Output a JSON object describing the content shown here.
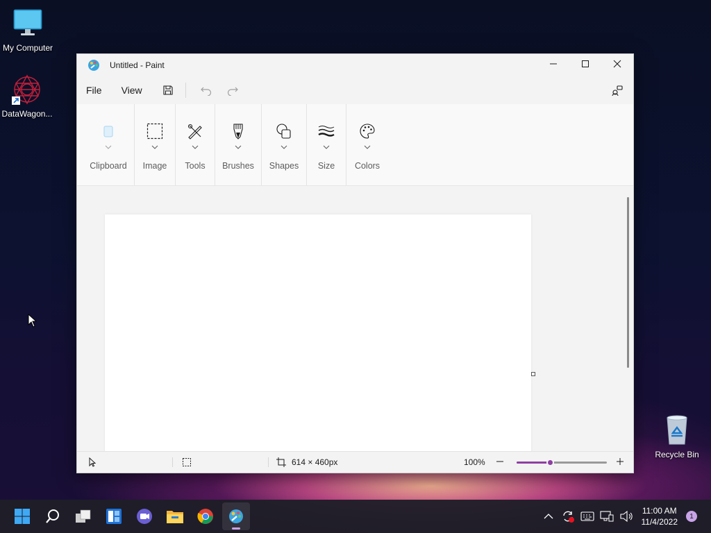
{
  "desktop": {
    "icons": [
      {
        "label": "My Computer"
      },
      {
        "label": "DataWagon..."
      },
      {
        "label": "Recycle Bin"
      }
    ]
  },
  "window": {
    "title": "Untitled - Paint",
    "app_icon": "paint-palette-icon"
  },
  "menubar": {
    "file": "File",
    "view": "View",
    "icons": [
      "save-icon",
      "undo-icon",
      "redo-icon",
      "share-icon"
    ]
  },
  "ribbon": {
    "groups": [
      {
        "label": "Clipboard",
        "icon": "clipboard-icon"
      },
      {
        "label": "Image",
        "icon": "selection-icon"
      },
      {
        "label": "Tools",
        "icon": "tools-icon"
      },
      {
        "label": "Brushes",
        "icon": "brush-icon"
      },
      {
        "label": "Shapes",
        "icon": "shapes-icon"
      },
      {
        "label": "Size",
        "icon": "stroke-size-icon"
      },
      {
        "label": "Colors",
        "icon": "palette-icon"
      }
    ]
  },
  "statusbar": {
    "canvas_size": "614 × 460px",
    "zoom": "100%",
    "zoom_fraction": 0.38
  },
  "taskbar": {
    "apps": [
      "start-icon",
      "search-icon",
      "task-view-icon",
      "widgets-icon",
      "chat-icon",
      "file-explorer-icon",
      "chrome-icon",
      "paint-icon"
    ],
    "time": "11:00 AM",
    "date": "11/4/2022",
    "notification_count": "1"
  },
  "colors": {
    "accent": "#8e3fa3",
    "taskbar": "#1e1e28",
    "window_bg": "#f9f9f9"
  }
}
